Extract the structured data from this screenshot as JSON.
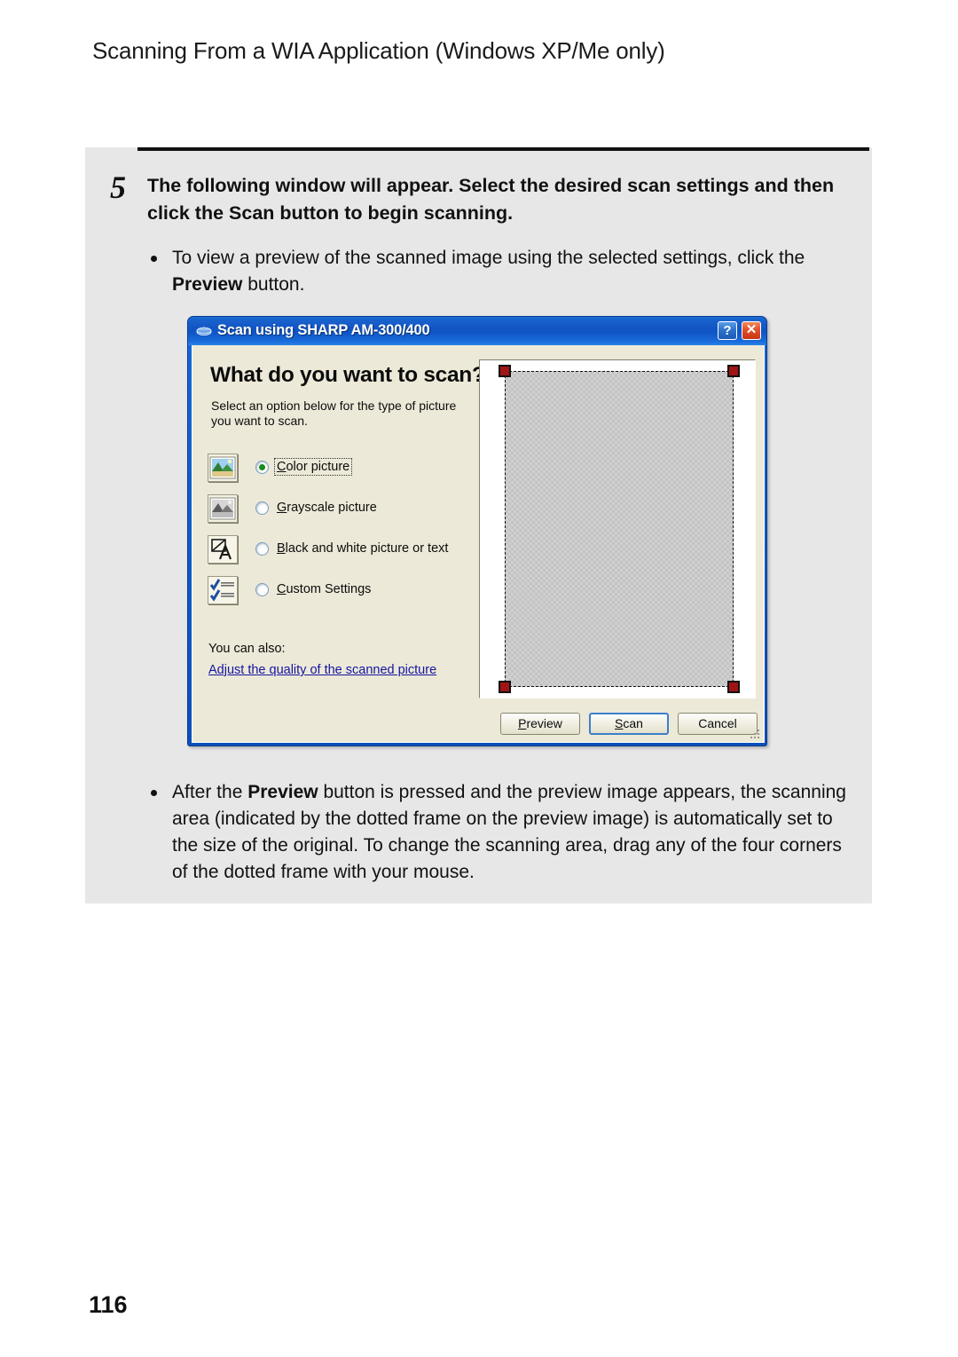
{
  "page": {
    "header": "Scanning From a WIA Application (Windows XP/Me only)",
    "number": "116"
  },
  "step": {
    "number": "5",
    "instruction": "The following window will appear. Select the desired scan settings and then click the Scan button to begin scanning.",
    "bullets": [
      {
        "before": "To view a preview of the scanned image using the selected settings, click the ",
        "bold": "Preview",
        "after": " button."
      },
      {
        "before": "After the ",
        "bold": "Preview",
        "after": " button is pressed and the preview image appears, the scanning area (indicated by the dotted frame on the preview image) is automatically set to the size of the original. To change the scanning area, drag any of the four corners of the dotted frame with your mouse."
      }
    ]
  },
  "dialog": {
    "title": "Scan using SHARP AM-300/400",
    "title_icon": "scanner-icon",
    "help_button": "?",
    "close_button": "✕",
    "heading": "What do you want to scan?",
    "subtext": "Select an option below for the type of picture you want to scan.",
    "options": [
      {
        "accel": "C",
        "rest": "olor picture",
        "icon": "color-picture-icon",
        "selected": true,
        "focused": true
      },
      {
        "accel": "G",
        "rest": "rayscale picture",
        "icon": "grayscale-picture-icon",
        "selected": false,
        "focused": false
      },
      {
        "accel": "B",
        "rest": "lack and white picture or text",
        "icon": "black-white-picture-icon",
        "selected": false,
        "focused": false
      },
      {
        "accel": "C",
        "rest": "ustom Settings",
        "icon": "custom-settings-icon",
        "selected": false,
        "focused": false
      }
    ],
    "also_label": "You can also:",
    "also_link": "Adjust the quality of the scanned picture",
    "buttons": [
      {
        "accel": "P",
        "rest": "review",
        "default": false
      },
      {
        "accel": "S",
        "rest": "can",
        "default": true
      },
      {
        "accel": "",
        "rest": "Cancel",
        "default": false
      }
    ],
    "colors": {
      "titlebar": "#1255c4",
      "dialog_face": "#ece9d8",
      "link": "#1515a0",
      "radio_dot": "#1a8a1a",
      "handle": "#a01414",
      "default_button_border": "#3c7fcd"
    }
  }
}
